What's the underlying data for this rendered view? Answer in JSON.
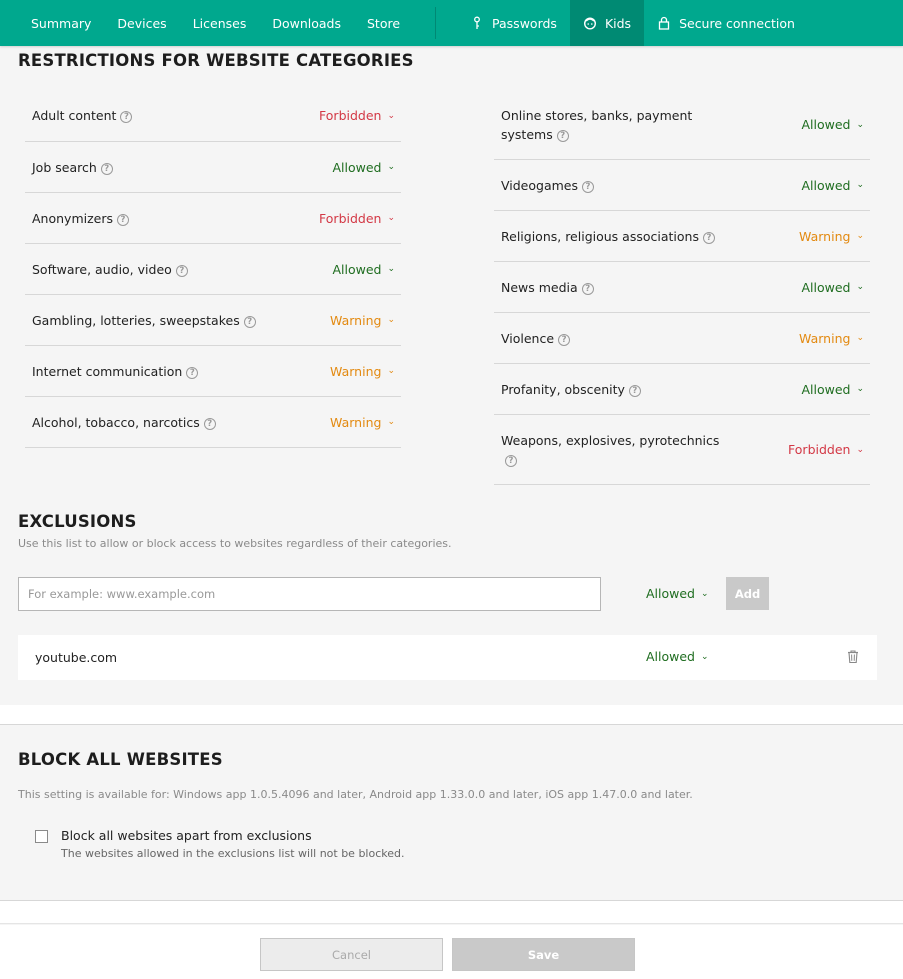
{
  "nav": {
    "items": [
      {
        "label": "Summary"
      },
      {
        "label": "Devices"
      },
      {
        "label": "Licenses"
      },
      {
        "label": "Downloads"
      },
      {
        "label": "Store"
      }
    ],
    "right_items": [
      {
        "label": "Passwords",
        "icon": "key-icon"
      },
      {
        "label": "Kids",
        "icon": "kid-face-icon"
      },
      {
        "label": "Secure connection",
        "icon": "lock-icon"
      }
    ],
    "active": "Kids",
    "color": "#00a88e"
  },
  "categories": {
    "title": "RESTRICTIONS FOR WEBSITE CATEGORIES",
    "left": [
      {
        "name": "Adult content",
        "status": "Forbidden"
      },
      {
        "name": "Job search",
        "status": "Allowed"
      },
      {
        "name": "Anonymizers",
        "status": "Forbidden"
      },
      {
        "name": "Software, audio, video",
        "status": "Allowed"
      },
      {
        "name": "Gambling, lotteries, sweepstakes",
        "status": "Warning"
      },
      {
        "name": "Internet communication",
        "status": "Warning"
      },
      {
        "name": "Alcohol, tobacco, narcotics",
        "status": "Warning"
      }
    ],
    "right": [
      {
        "name": "Online stores, banks, payment systems",
        "status": "Allowed"
      },
      {
        "name": "Videogames",
        "status": "Allowed"
      },
      {
        "name": "Religions, religious associations",
        "status": "Warning"
      },
      {
        "name": "News media",
        "status": "Allowed"
      },
      {
        "name": "Violence",
        "status": "Warning"
      },
      {
        "name": "Profanity, obscenity",
        "status": "Allowed"
      },
      {
        "name": "Weapons, explosives, pyrotechnics",
        "status": "Forbidden"
      }
    ],
    "status_colors": {
      "Allowed": "#1f6d20",
      "Forbidden": "#d33845",
      "Warning": "#e38a11"
    }
  },
  "exclusions": {
    "title": "EXCLUSIONS",
    "description": "Use this list to allow or block access to websites regardless of their categories.",
    "input_placeholder": "For example: www.example.com",
    "input_value": "",
    "new_status": "Allowed",
    "add_label": "Add",
    "items": [
      {
        "site": "youtube.com",
        "status": "Allowed"
      }
    ]
  },
  "block_all": {
    "title": "BLOCK ALL WEBSITES",
    "availability": "This setting is available for: Windows app 1.0.5.4096 and later, Android app 1.33.0.0 and later, iOS app 1.47.0.0 and later.",
    "checkbox_label": "Block all websites apart from exclusions",
    "checkbox_sub": "The websites allowed in the exclusions list will not be blocked.",
    "checked": false
  },
  "footer": {
    "cancel_label": "Cancel",
    "save_label": "Save"
  }
}
